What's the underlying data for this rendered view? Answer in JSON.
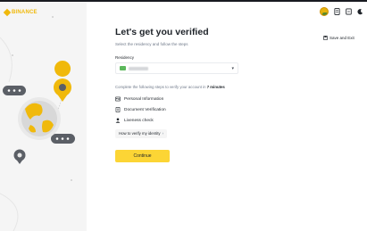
{
  "brand": {
    "name": "BINANCE",
    "accent": "#f0b90b"
  },
  "header": {
    "icons": [
      "avatar",
      "documents-icon",
      "language-icon",
      "dark-mode-icon"
    ]
  },
  "save_exit": {
    "label": "Save and Exit",
    "icon": "save-icon"
  },
  "main": {
    "title": "Let's get you verified",
    "subtitle": "Select the residency and follow the steps",
    "residency_label": "Residency",
    "steps_intro": "Complete the following steps to verify your account in",
    "steps_time": "7 minutes",
    "steps": [
      {
        "label": "Personal Information",
        "icon": "id-card-icon"
      },
      {
        "label": "Document Verification",
        "icon": "document-icon"
      },
      {
        "label": "Liveness check",
        "icon": "person-icon"
      }
    ],
    "howto_label": "How to verify my identity",
    "continue_label": "Continue"
  },
  "colors": {
    "primary_button": "#fcd535",
    "text": "#1e2329",
    "muted": "#707a8a"
  }
}
